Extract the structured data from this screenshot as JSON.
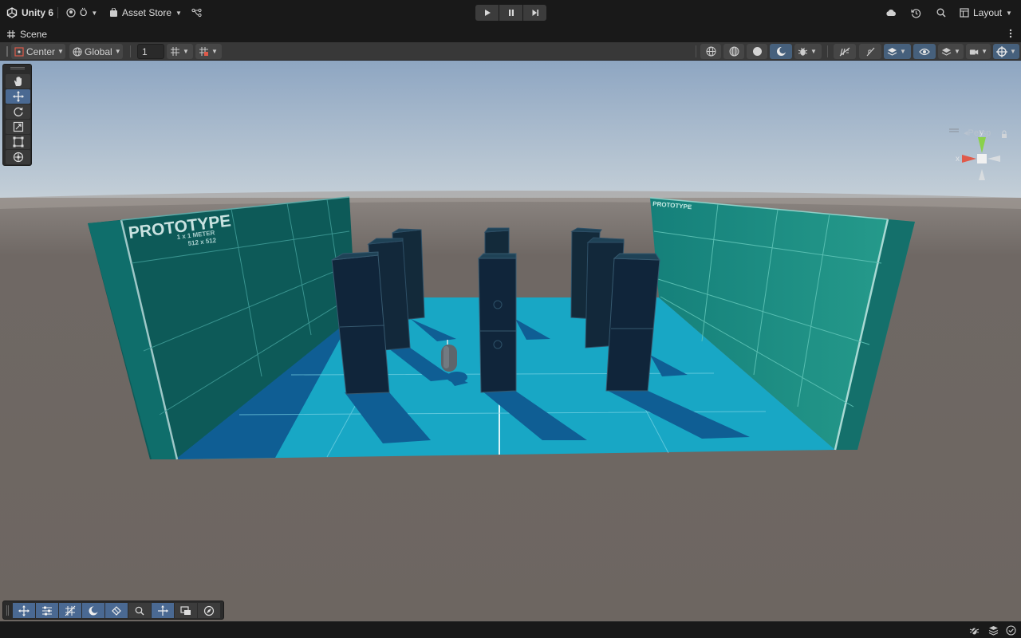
{
  "app": {
    "title": "Unity 6",
    "account_label": "Ö",
    "asset_store_label": "Asset Store",
    "layout_label": "Layout"
  },
  "scene_tab": {
    "label": "Scene"
  },
  "toolbar": {
    "pivot_label": "Center",
    "space_label": "Global",
    "grid_snap_value": "1"
  },
  "viewport": {
    "projection_label": "Persp",
    "axis_x_label": "x",
    "axis_y_label": "y",
    "wall_texture_title": "PROTOTYPE",
    "wall_texture_line1": "1 x 1 METER",
    "wall_texture_line2": "512 x 512"
  },
  "colors": {
    "active_accent": "#4a6992",
    "floor": "#18a7c5",
    "wall": "#0d5a58",
    "pillar": "#132a3a",
    "sky_top": "#8ea6c2",
    "ground": "#6e6762"
  },
  "icons": {
    "unity_logo": "unity-logo-icon",
    "account": "account-icon",
    "asset_store": "asset-store-bag-icon",
    "version_control": "branch-icon",
    "cloud": "cloud-icon",
    "history": "history-icon",
    "search": "search-icon",
    "layout": "layout-icon"
  }
}
